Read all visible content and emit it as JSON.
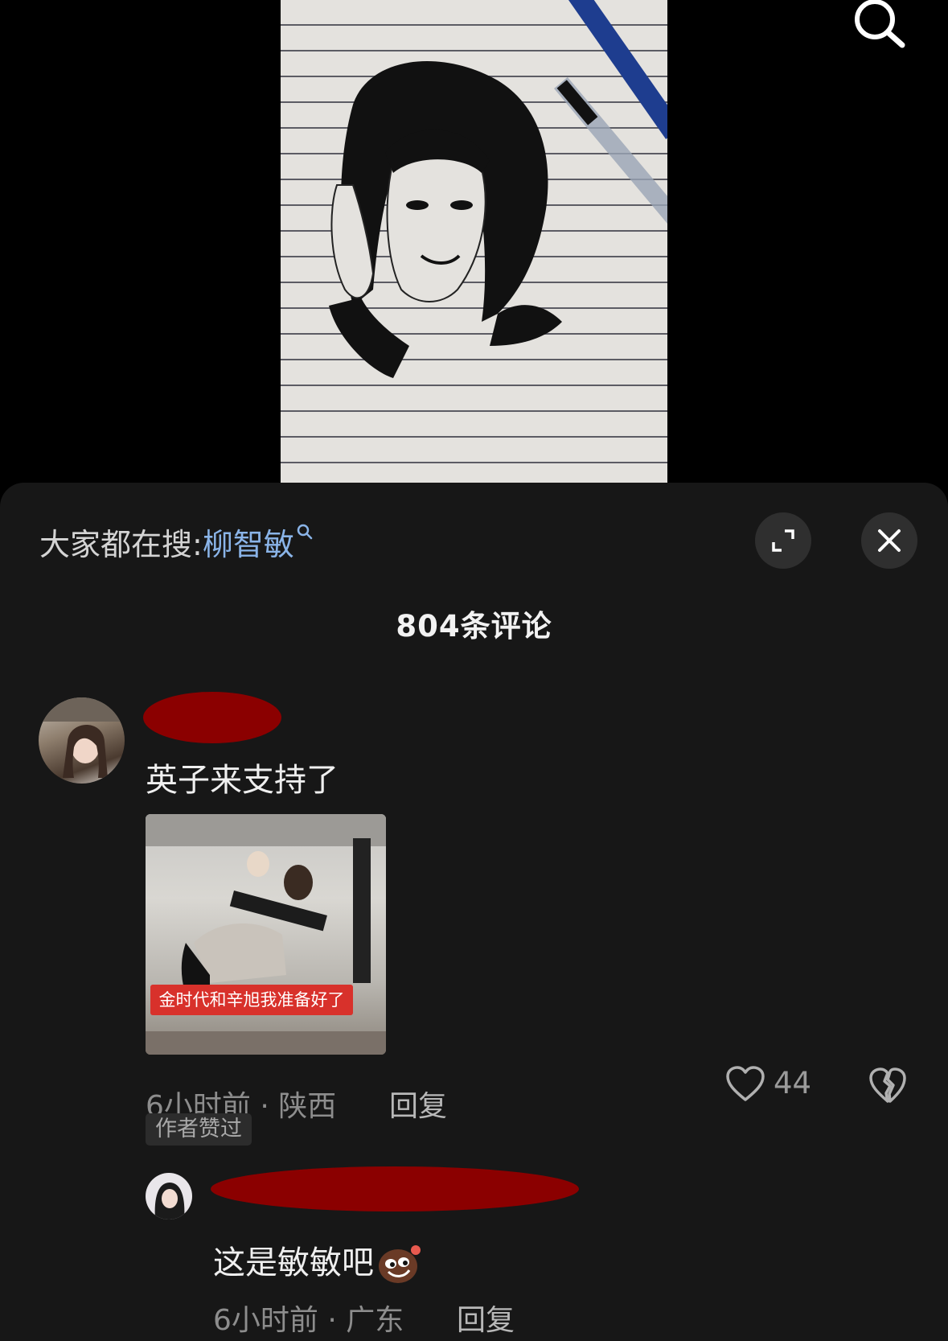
{
  "header": {
    "hot_search_prefix": "大家都在搜:",
    "hot_search_keyword": "柳智敏",
    "comment_count": "804条评论"
  },
  "comments": [
    {
      "text": "英子来支持了",
      "image_caption": "金时代和辛旭我准备好了",
      "time_location": "6小时前 · 陕西",
      "reply_label": "回复",
      "badge": "作者赞过",
      "likes": "44"
    }
  ],
  "replies": [
    {
      "text": "这是敏敏吧",
      "time_location": "6小时前 · 广东",
      "reply_label": "回复"
    }
  ],
  "colors": {
    "sheet_bg": "#171717",
    "keyword": "#8ab4e8",
    "redaction": "#8b0000"
  },
  "icons": [
    "search-icon",
    "search-small-icon",
    "expand-icon",
    "close-icon",
    "heart-icon",
    "broken-heart-icon",
    "emoji-icon"
  ]
}
